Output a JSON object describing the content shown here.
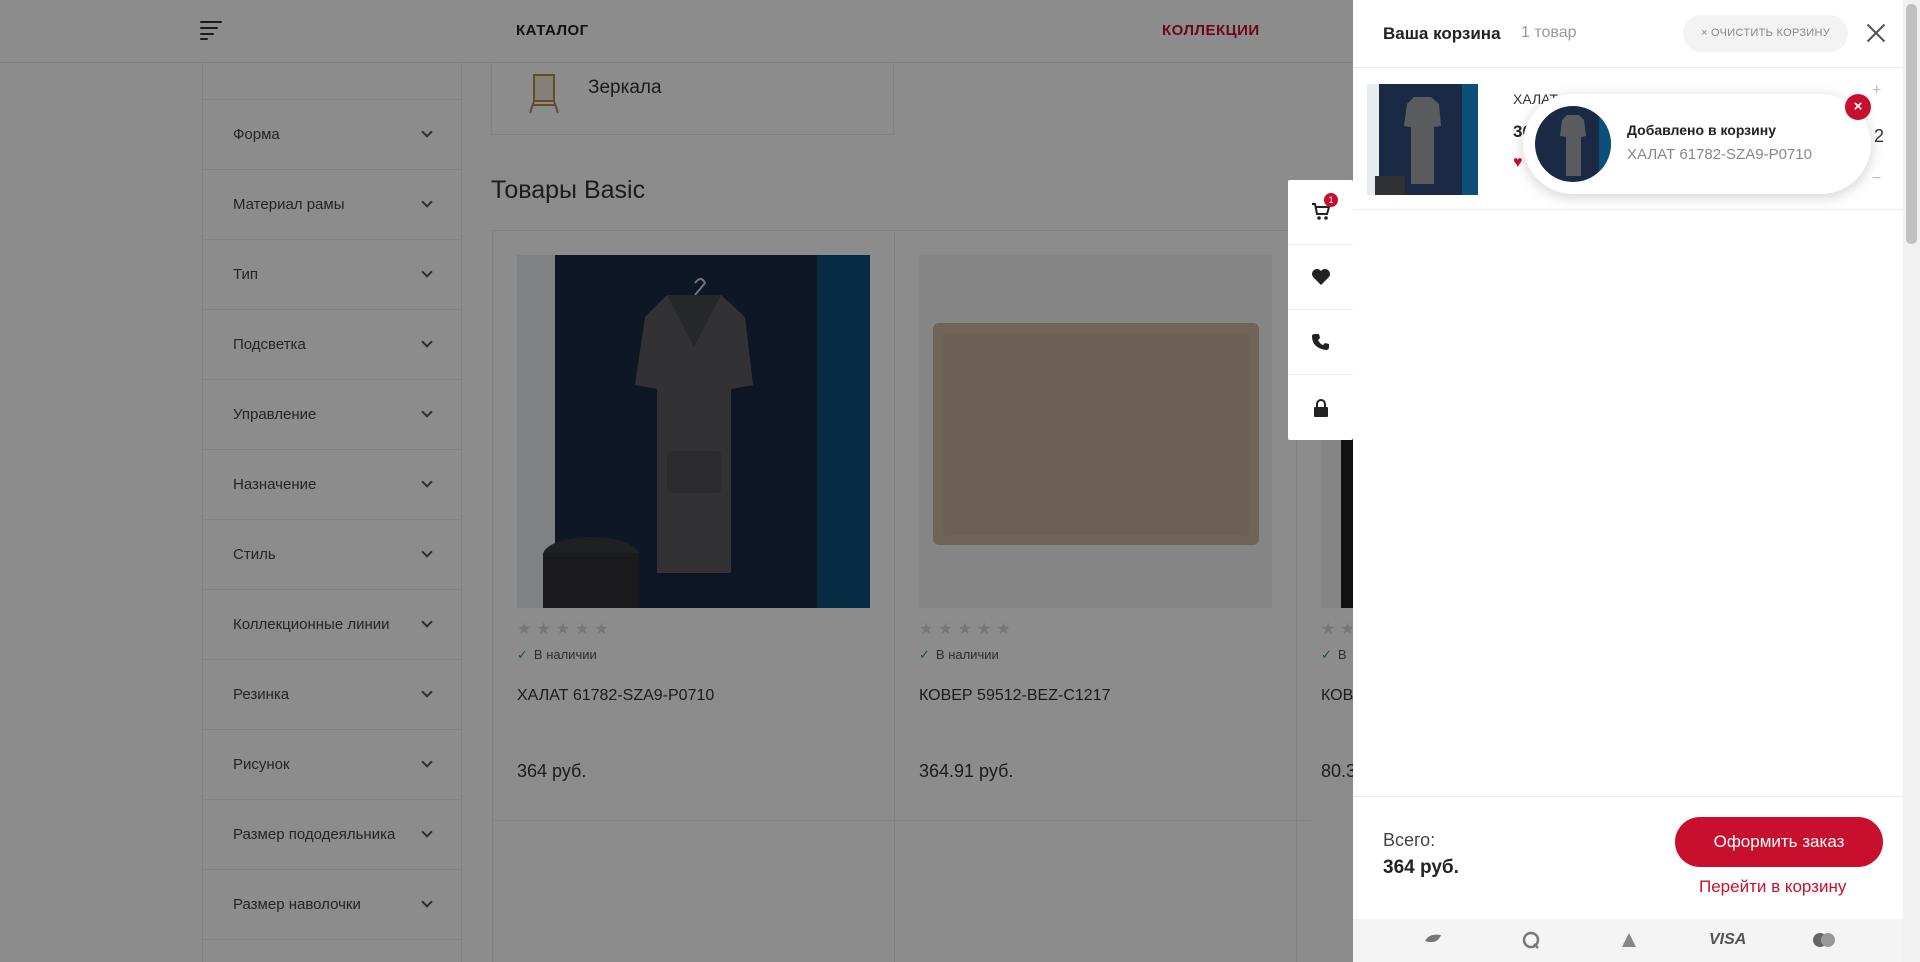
{
  "header": {
    "catalog_label": "КАТАЛОГ",
    "collections_label": "КОЛЛЕКЦИИ",
    "accent_color": "#c8102e"
  },
  "sidebar": {
    "filters": [
      {
        "label": "Форма"
      },
      {
        "label": "Материал рамы"
      },
      {
        "label": "Тип"
      },
      {
        "label": "Подсветка"
      },
      {
        "label": "Управление"
      },
      {
        "label": "Назначение"
      },
      {
        "label": "Стиль"
      },
      {
        "label": "Коллекционные линии"
      },
      {
        "label": "Резинка"
      },
      {
        "label": "Рисунок"
      },
      {
        "label": "Размер пододеяльника"
      },
      {
        "label": "Размер наволочки"
      }
    ]
  },
  "category": {
    "label": "Зеркала"
  },
  "section": {
    "title": "Товары Basic"
  },
  "products": [
    {
      "availability": "В наличии",
      "name": "ХАЛАТ 61782-SZA9-P0710",
      "price": "364 руб.",
      "rating": 0
    },
    {
      "availability": "В наличии",
      "name": "КОВЕР 59512-BEZ-C1217",
      "price": "364.91 руб.",
      "rating": 0
    },
    {
      "availability": "В",
      "name": "КОВ",
      "price": "80.3",
      "rating": 0
    }
  ],
  "fab": {
    "cart_count": "1",
    "icons": [
      "cart-icon",
      "heart-icon",
      "phone-icon",
      "lock-icon"
    ]
  },
  "cart": {
    "title": "Ваша корзина",
    "count_text": "1 товар",
    "clear_label": "× ОЧИСТИТЬ КОРЗИНУ",
    "item": {
      "name": "ХАЛАТ",
      "price": "36",
      "quantity": "2",
      "plus": "+",
      "minus": "−"
    },
    "toast": {
      "title": "Добавлено в корзину",
      "subtitle": "ХАЛАТ 61782-SZA9-P0710",
      "close": "×"
    },
    "total_label": "Всего:",
    "total_value": "364 руб.",
    "order_button": "Оформить заказ",
    "go_to_cart": "Перейти в корзину",
    "payments": [
      "sber-icon",
      "qiwi-icon",
      "yandex-icon",
      "VISA",
      "mastercard-icon"
    ]
  }
}
